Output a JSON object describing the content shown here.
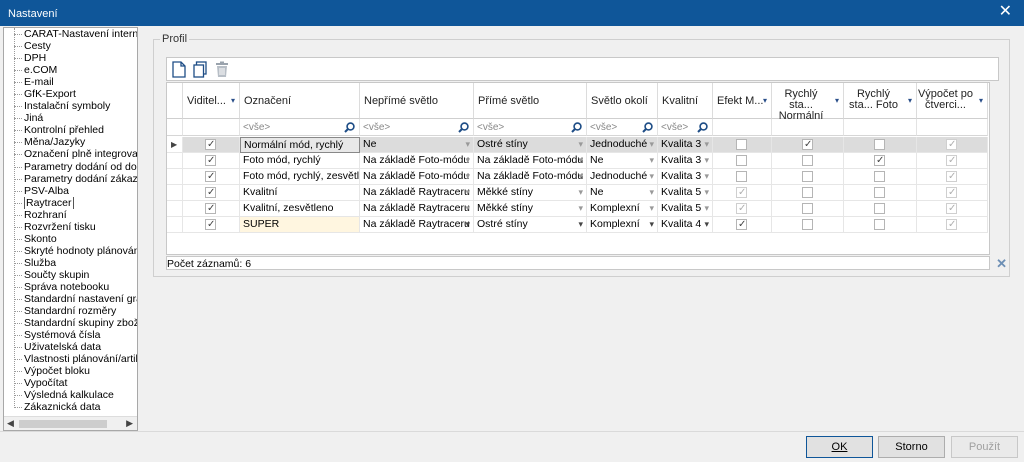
{
  "window": {
    "title": "Nastavení",
    "close": "✕"
  },
  "tree": {
    "items": [
      "CARAT-Nastavení internetu",
      "Cesty",
      "DPH",
      "e.COM",
      "E-mail",
      "GfK-Export",
      "Instalační symboly",
      "Jiná",
      "Kontrolní přehled",
      "Měna/Jazyky",
      "Označení plně integrovaných",
      "Parametry dodání od dodava",
      "Parametry dodání zákazníkov",
      "PSV-Alba",
      "Raytracer",
      "Rozhraní",
      "Rozvržení tisku",
      "Skonto",
      "Skryté hodnoty plánování",
      "Služba",
      "Součty skupin",
      "Správa notebooku",
      "Standardní nastavení grafiky",
      "Standardní rozměry",
      "Standardní skupiny zboží",
      "Systémová čísla",
      "Uživatelská data",
      "Vlastnosti plánování/artiklů",
      "Výpočet bloku",
      "Vypočítat",
      "Výsledná kalkulace",
      "Zákaznická data"
    ],
    "selected_index": 14
  },
  "profil": {
    "legend": "Profil",
    "columns": [
      "Viditel...",
      "Označení",
      "Nepřímé světlo",
      "Přímé světlo",
      "Světlo okolí",
      "Kvalitní",
      "Efekt M...",
      "Rychlý sta... Normální",
      "Rychlý sta... Foto",
      "Výpočet po čtverci..."
    ],
    "filter_placeholder": "<vše>",
    "rows": [
      {
        "visible": true,
        "name": "Normální mód, rychlý",
        "indirect": "Ne",
        "direct": "Ostré stíny",
        "ambient": "Jednoduché",
        "quality": "Kvalita 3",
        "effect": false,
        "fast_normal": true,
        "fast_photo": false,
        "calc": true
      },
      {
        "visible": true,
        "name": "Foto mód, rychlý",
        "indirect": "Na základě Foto-módu",
        "direct": "Na základě Foto-módu",
        "ambient": "Ne",
        "quality": "Kvalita 3",
        "effect": false,
        "fast_normal": false,
        "fast_photo": true,
        "calc": true
      },
      {
        "visible": true,
        "name": "Foto mód, rychlý, zesvětleno",
        "indirect": "Na základě Foto-módu",
        "direct": "Na základě Foto-módu",
        "ambient": "Jednoduché",
        "quality": "Kvalita 3",
        "effect": false,
        "fast_normal": false,
        "fast_photo": false,
        "calc": true
      },
      {
        "visible": true,
        "name": "Kvalitní",
        "indirect": "Na základě Raytraceru",
        "direct": "Měkké stíny",
        "ambient": "Ne",
        "quality": "Kvalita 5",
        "effect": true,
        "fast_normal": false,
        "fast_photo": false,
        "calc": true
      },
      {
        "visible": true,
        "name": "Kvalitní, zesvětleno",
        "indirect": "Na základě Raytraceru",
        "direct": "Měkké stíny",
        "ambient": "Komplexní",
        "quality": "Kvalita 5",
        "effect": true,
        "fast_normal": false,
        "fast_photo": false,
        "calc": true
      },
      {
        "visible": true,
        "name": "SUPER",
        "indirect": "Na základě Raytraceru",
        "direct": "Ostré stíny",
        "ambient": "Komplexní",
        "quality": "Kvalita 4",
        "effect": true,
        "fast_normal": false,
        "fast_photo": false,
        "calc": true
      }
    ],
    "record_count": "Počet záznamů: 6",
    "colors": {
      "selected_row": "#dcdcdc",
      "highlight_cell": "#fff6e0",
      "title_bar": "#0f5699"
    }
  },
  "buttons": {
    "ok": "OK",
    "cancel": "Storno",
    "apply": "Použít"
  }
}
